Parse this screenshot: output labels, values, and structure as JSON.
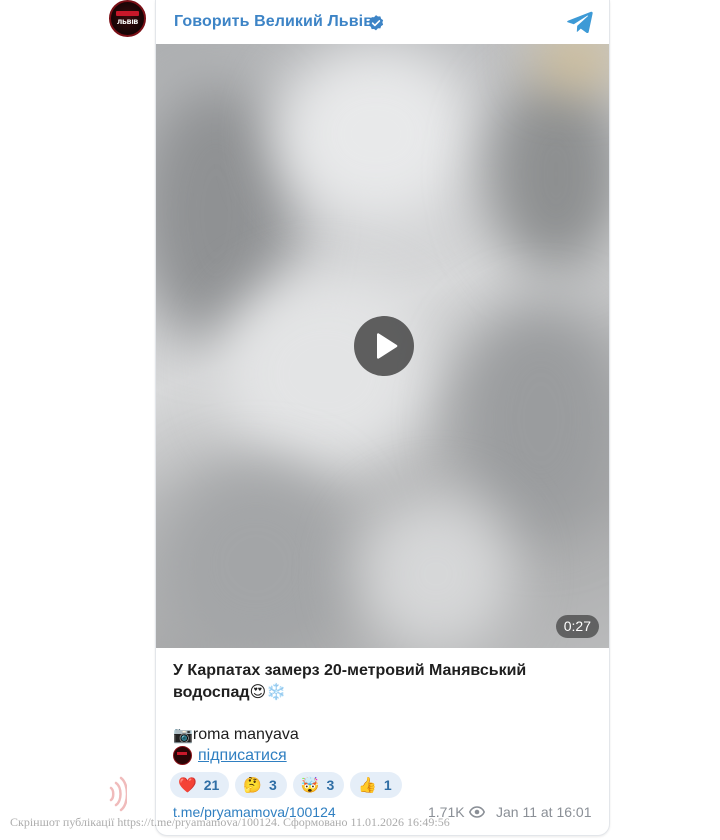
{
  "channel": {
    "name": "Говорить Великий Львів",
    "avatar_text": "ЛЬВІВ",
    "verified": true
  },
  "post": {
    "video_duration": "0:27",
    "caption_title": "У Карпатах замерз 20-метровий Манявський водоспад",
    "caption_emojis": "😍❄️",
    "camera_emoji": "📷",
    "credit": "roma manyava",
    "subscribe_label": "підписатися",
    "reactions": [
      {
        "emoji": "❤️",
        "count": "21"
      },
      {
        "emoji": "🤔",
        "count": "3"
      },
      {
        "emoji": "🤯",
        "count": "3"
      },
      {
        "emoji": "👍",
        "count": "1"
      }
    ],
    "link": "t.me/pryamamova/100124",
    "views": "1.71K",
    "date": "Jan 11 at 16:01"
  },
  "watermark": "Скріншот публікації https://t.me/pryamamova/100124. Сформовано 11.01.2026 16:49:56",
  "icons": {
    "verified": "verified-badge-icon",
    "telegram": "telegram-plane-icon",
    "play": "play-icon",
    "eye": "eye-icon",
    "camera": "camera-icon"
  },
  "colors": {
    "accent": "#3d84c6",
    "link": "#2f7fc1",
    "reaction_bg": "#e5eef8",
    "meta": "#8a8f96"
  }
}
